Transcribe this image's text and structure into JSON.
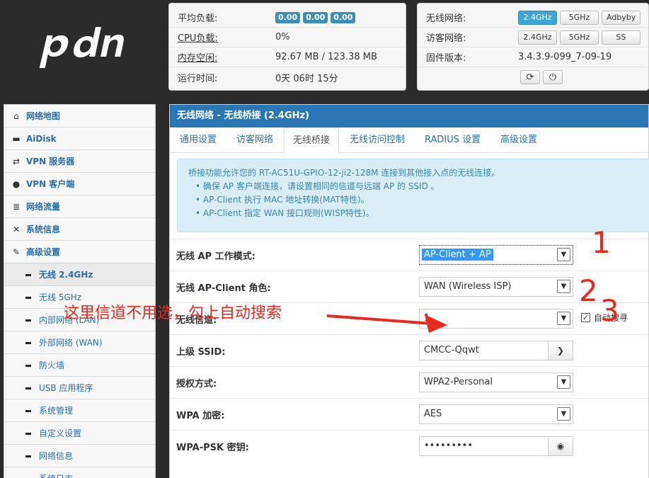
{
  "logo": {
    "text": "pdcn"
  },
  "system_panel": {
    "avg_load_label": "平均负载:",
    "avg_load_values": [
      "0.00",
      "0.00",
      "0.00"
    ],
    "cpu_label": "CPU负载:",
    "cpu_value": "0%",
    "mem_label": "内存空闲:",
    "mem_value": "92.67 MB / 123.38 MB",
    "uptime_label": "运行时间:",
    "uptime_value": "0天 06时 15分"
  },
  "wireless_panel": {
    "wireless_label": "无线网络:",
    "wireless_buttons": [
      "2.4GHz",
      "5GHz",
      "Adbyby"
    ],
    "guest_label": "访客网络:",
    "guest_buttons": [
      "2.4GHz",
      "5GHz",
      "SS"
    ],
    "firmware_label": "固件版本:",
    "firmware_value": "3.4.3.9-099_7-09-19"
  },
  "sidebar": {
    "items": [
      {
        "label": "网络地图",
        "icon": "home-icon"
      },
      {
        "label": "AiDisk",
        "icon": "disk-icon"
      },
      {
        "label": "VPN 服务器",
        "icon": "retweet-icon"
      },
      {
        "label": "VPN 客户端",
        "icon": "globe-icon"
      },
      {
        "label": "网络流量",
        "icon": "list-icon"
      },
      {
        "label": "系统信息",
        "icon": "shuffle-icon"
      },
      {
        "label": "高级设置",
        "icon": "wrench-icon"
      }
    ],
    "sub_items": [
      "无线 2.4GHz",
      "无线 5GHz",
      "内部网络 (LAN)",
      "外部网络 (WAN)",
      "防火墙",
      "USB 应用程序",
      "系统管理",
      "自定义设置",
      "网络信息",
      "系统日志"
    ]
  },
  "main": {
    "title": "无线网络 - 无线桥接 (2.4GHz)",
    "tabs": [
      "通用设置",
      "访客网络",
      "无线桥接",
      "无线访问控制",
      "RADIUS 设置",
      "高级设置"
    ],
    "info": {
      "intro": "桥接功能允许您的 RT-AC51U-GPIO-12-ji2-128M 连接到其他接入点的无线连接。",
      "bullets": [
        "•  确保 AP 客户端连接，请设置相同的信道与远端 AP 的 SSID 。",
        "•  AP-Client 执行 MAC 地址转换(MAT特性)。",
        "•  AP-Client 指定 WAN 接口规则(WISP特性)。"
      ]
    },
    "fields": {
      "mode_label": "无线 AP 工作模式:",
      "mode_value": "AP-Client + AP",
      "role_label": "无线 AP-Client 角色:",
      "role_value": "WAN (Wireless ISP)",
      "channel_label": "无线信道:",
      "channel_value": "1",
      "auto_search_label": "自动搜寻",
      "auto_search_checked": true,
      "ssid_label": "上级 SSID:",
      "ssid_value": "CMCC-Qqwt",
      "auth_label": "授权方式:",
      "auth_value": "WPA2-Personal",
      "enc_label": "WPA 加密:",
      "enc_value": "AES",
      "psk_label": "WPA-PSK 密钥:",
      "psk_value": "•••••••••"
    }
  },
  "annotations": {
    "note": "这里信道不用选，勾上自动搜索",
    "num1": "1",
    "num2": "2",
    "num3": "3",
    "color": "#e52b20"
  }
}
